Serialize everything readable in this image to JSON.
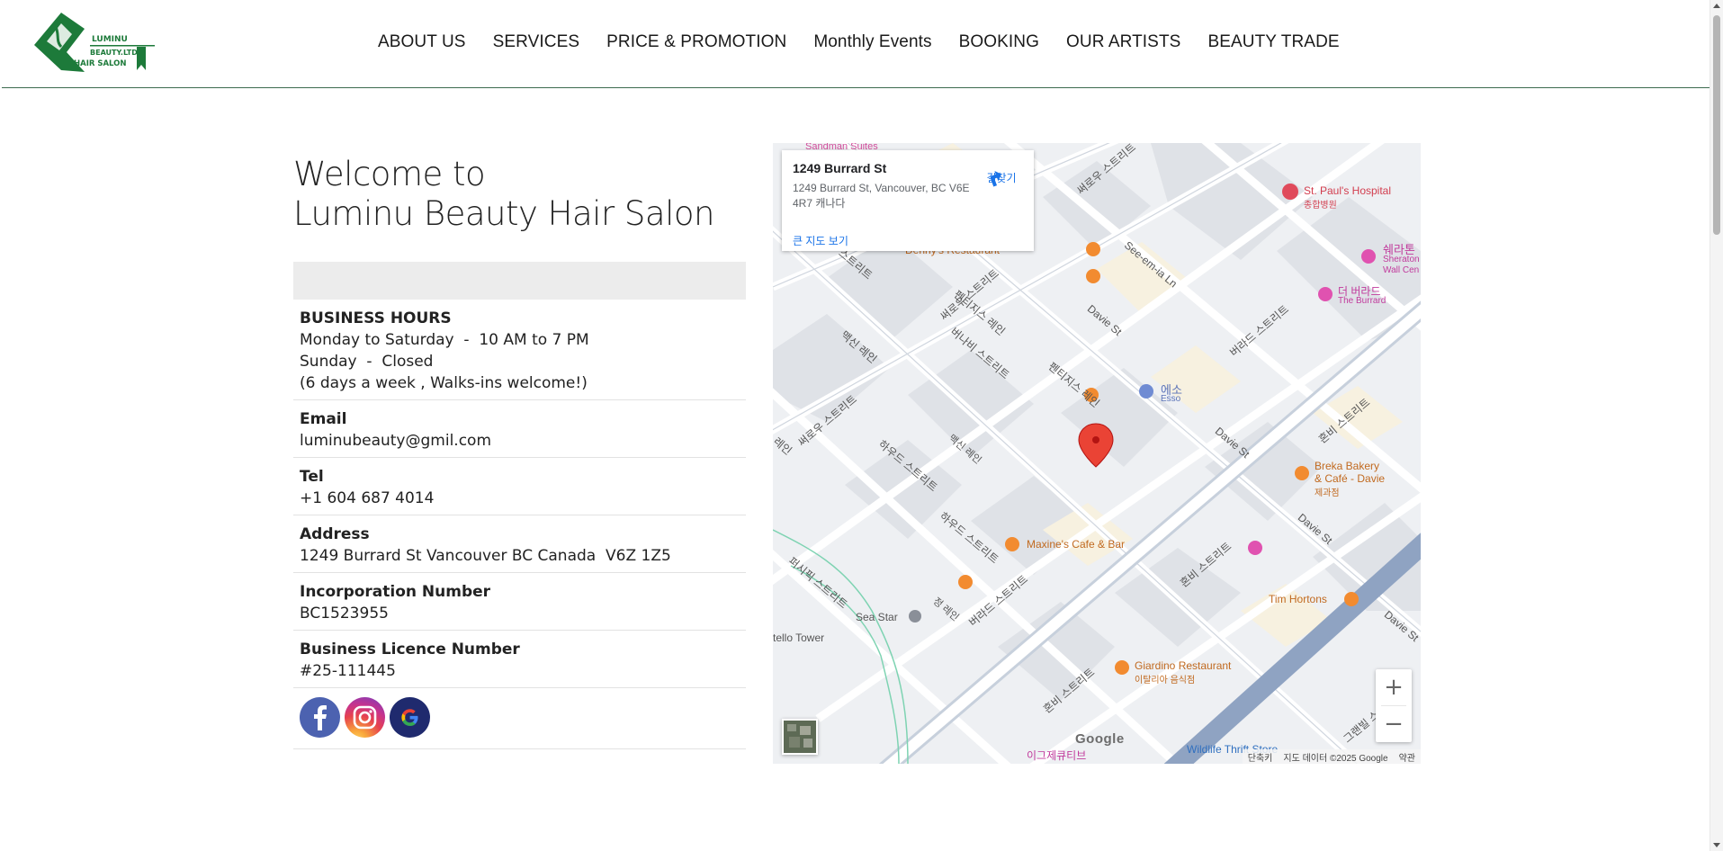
{
  "colors": {
    "brand_green": "#1d7a3a",
    "header_border": "#3d6b4f",
    "facebook": "#4c62b0",
    "google_circle": "#1f2a6e",
    "map_link": "#1a73e8",
    "map_pin": "#ea4335"
  },
  "logo": {
    "line1": "LUMINU",
    "line2": "BEAUTY.LTD",
    "line3": "HAIR SALON"
  },
  "nav": {
    "items": [
      {
        "label": "ABOUT US"
      },
      {
        "label": "SERVICES"
      },
      {
        "label": "PRICE & PROMOTION"
      },
      {
        "label": "Monthly Events"
      },
      {
        "label": "BOOKING"
      },
      {
        "label": "OUR ARTISTS"
      },
      {
        "label": "BEAUTY TRADE"
      }
    ]
  },
  "welcome": {
    "line1": "Welcome to",
    "line2": "Luminu Beauty Hair Salon"
  },
  "info": {
    "hours_title": "BUSINESS HOURS",
    "hours_line1": "Monday to Saturday  -  10 AM to 7 PM",
    "hours_line2": "Sunday  -  Closed",
    "hours_line3": "(6 days a week , Walks-ins welcome!)",
    "email_title": "Email",
    "email_value": "luminubeauty@gmil.com",
    "tel_title": "Tel",
    "tel_value": "+1 604 687 4014",
    "address_title": "Address",
    "address_value": "1249 Burrard St Vancouver BC Canada  V6Z 1Z5",
    "incorporation_title": "Incorporation Number",
    "incorporation_value": "BC1523955",
    "licence_title": "Business Licence Number",
    "licence_value": "#25-111445"
  },
  "social": {
    "icons": [
      "facebook-icon",
      "instagram-icon",
      "google-icon"
    ]
  },
  "map": {
    "card_title": "1249 Burrard St",
    "card_address": "1249 Burrard St, Vancouver, BC V6E 4R7 캐나다",
    "card_link": "큰 지도 보기",
    "directions_label": "길찾기",
    "zoom_in": "+",
    "zoom_out": "−",
    "google": "Google",
    "footer_shortcuts": "단축키",
    "footer_data": "지도 데이터 ©2025 Google",
    "footer_terms": "약관",
    "labels": {
      "sandman": "Sandman Suites",
      "dennys": "Denny's Restaurant",
      "st_pauls": "St. Paul's Hospital",
      "st_pauls_ko": "종합병원",
      "sheraton_ko": "쉐라톤",
      "sheraton_1": "Sheraton",
      "sheraton_2": "Wall Cen",
      "burrard_ko": "더 버라드",
      "burrard_en": "The Burrard",
      "see_em_ia": "See-em-ia Ln",
      "davie_1": "Davie St",
      "davie_2": "Davie St",
      "davie_3": "Davie St",
      "davie_4": "Davie St",
      "esso_ko": "에소",
      "esso_en": "Esso",
      "breka_1": "Breka Bakery",
      "breka_2": "& Café - Davie",
      "breka_3": "제과점",
      "maxines": "Maxine's Cafe & Bar",
      "tim_hortons": "Tim Hortons",
      "sea_star": "Sea Star",
      "giardino_1": "Giardino Restaurant",
      "giardino_2": "이탈리아 음식점",
      "tello_tower": "tello Tower",
      "wildlife": "Wildlife Thrift Store",
      "igeuje": "이그제큐티브",
      "r_thurlow": "써로우 스트리트",
      "r_thurlow2": "써로우 스트리트",
      "r_bute": "버나비 스트리트",
      "r_pender": "펜티지스 레인",
      "r_pender2": "펜티지스 레인",
      "r_macsin": "맥신 레인",
      "r_macsin2": "맥신 레인",
      "r_howe": "하우드 스트리트",
      "r_howe2": "하우드 스트리트",
      "r_burrard": "버라드 스트리트",
      "r_burrard2": "버라드 스트리트",
      "r_hornby": "혼비 스트리트",
      "r_hornby2": "혼비 스트리트",
      "r_hornby3": "혼비 스트리트",
      "r_pacific": "퍼시픽 스트리트",
      "r_jung": "정 레인",
      "r_street": "스트리트",
      "r_lane": "레인",
      "r_granville": "그랜빌 스"
    }
  }
}
